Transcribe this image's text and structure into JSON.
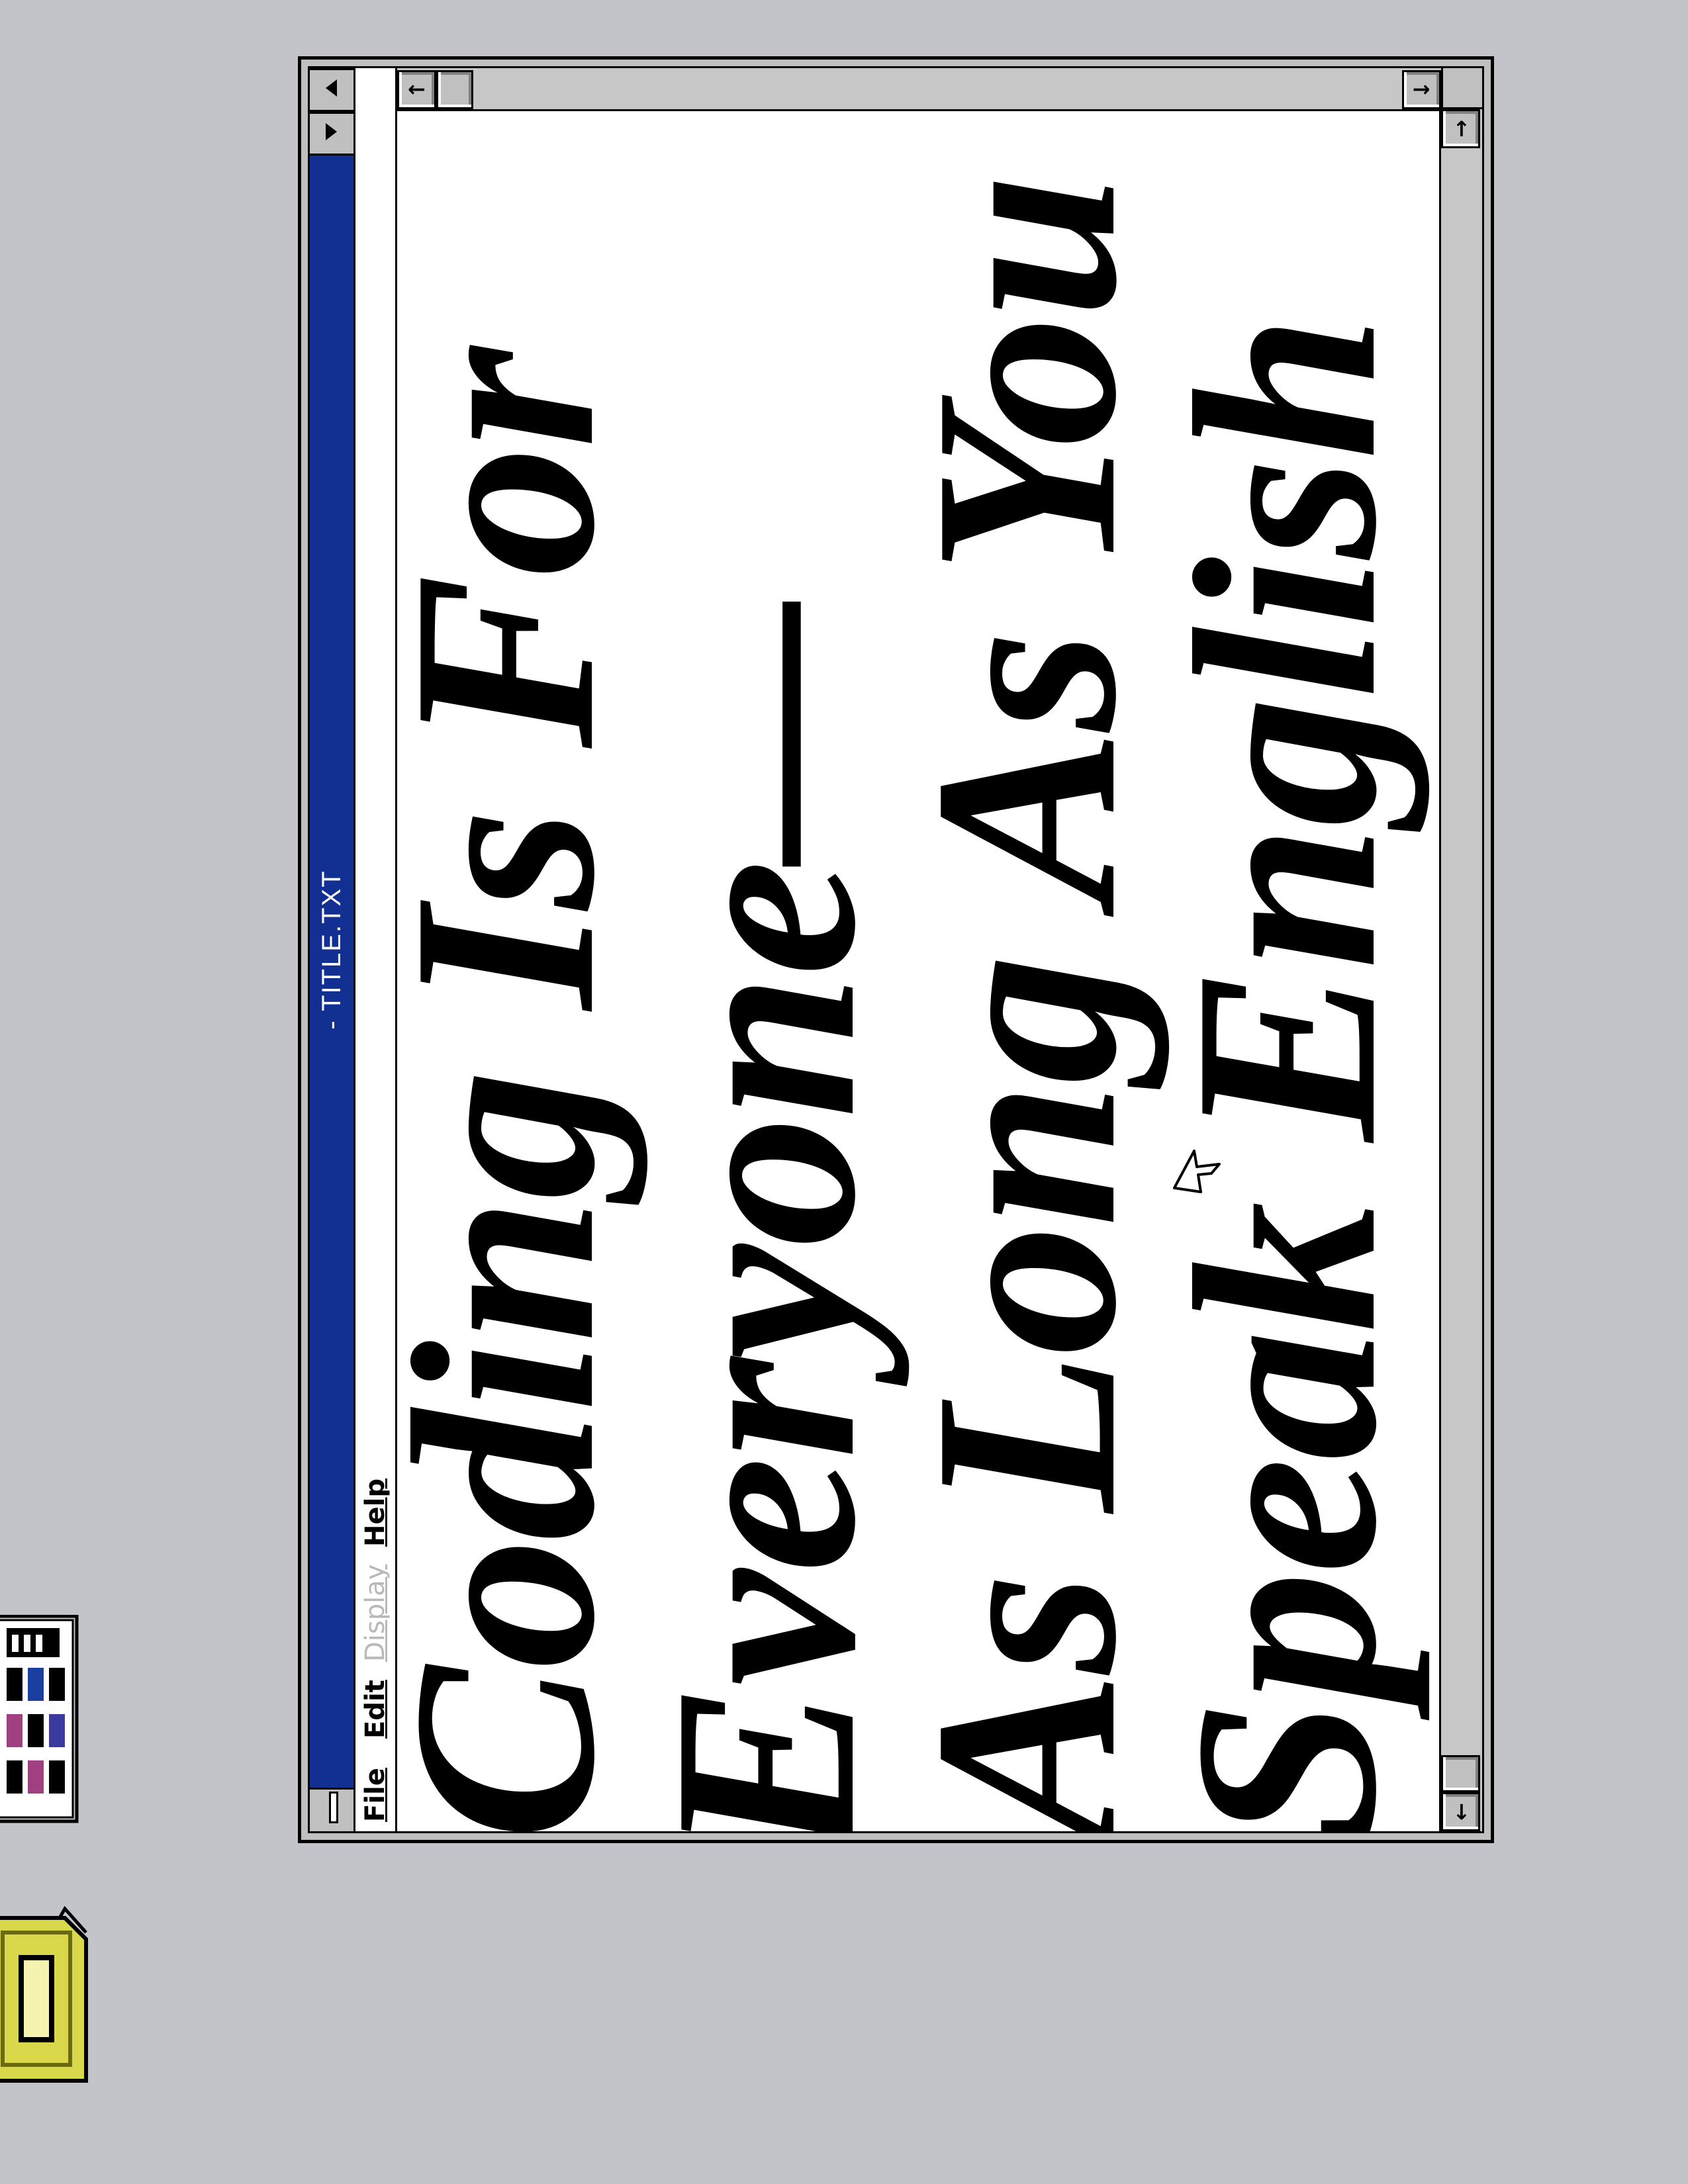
{
  "window": {
    "title": "- TITLE.TXT",
    "menu": [
      "File",
      "Edit",
      "Display",
      "Help"
    ],
    "disabled_menu": "Display"
  },
  "document": {
    "lines": [
      "Coding Is For",
      "Everyone—",
      "As Long As You",
      "Speak English"
    ]
  },
  "scrollbars": {
    "up_arrow": "↑",
    "down_arrow": "↓",
    "left_arrow": "←",
    "right_arrow": "→"
  },
  "icons": {
    "desktop": [
      "program-group-icon",
      "folder-icon"
    ],
    "system": [
      "system-menu-icon",
      "minimize-icon",
      "maximize-icon"
    ],
    "pointer": "mouse-pointer-icon"
  },
  "colors": {
    "desktop": "#c3c4c9",
    "titlebar": "#123091",
    "title_text": "#ffffff",
    "document_bg": "#ffffff",
    "text": "#000000",
    "disabled_menu": "#b9b9b9",
    "folder": "#d8d84a"
  }
}
